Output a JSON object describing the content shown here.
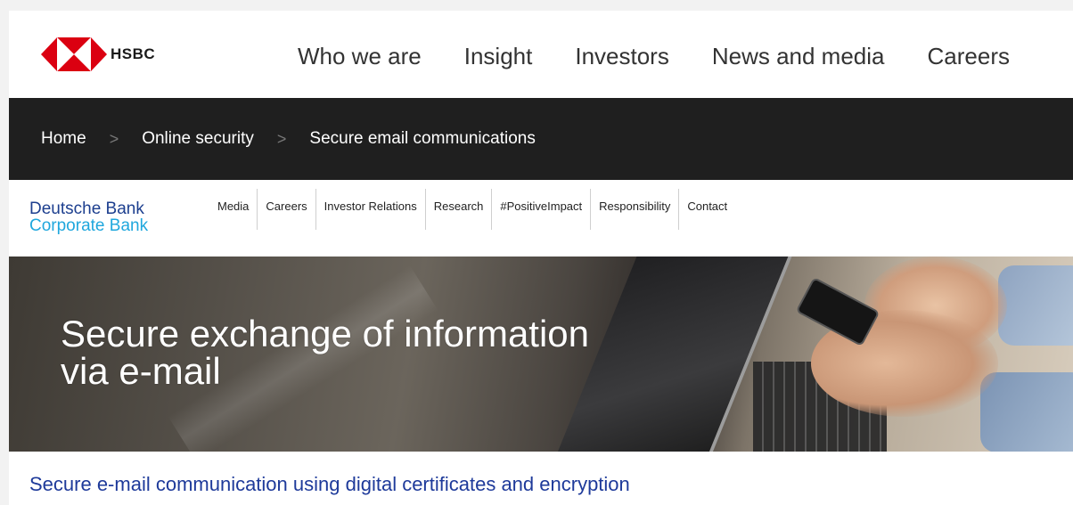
{
  "hsbc": {
    "logo_text": "HSBC",
    "nav": [
      "Who we are",
      "Insight",
      "Investors",
      "News and media",
      "Careers"
    ]
  },
  "breadcrumb": {
    "items": [
      "Home",
      "Online security",
      "Secure email communications"
    ],
    "separator": ">"
  },
  "deutsche_bank": {
    "brand_line1": "Deutsche Bank",
    "brand_line2": "Corporate Bank",
    "nav": [
      "Media",
      "Careers",
      "Investor Relations",
      "Research",
      "#PositiveImpact",
      "Responsibility",
      "Contact"
    ]
  },
  "hero": {
    "title_line1": "Secure exchange of information",
    "title_line2": "via e-mail"
  },
  "subheading": "Secure e-mail communication using digital certificates and encryption",
  "colors": {
    "hsbc_red": "#db0011",
    "breadcrumb_bg": "#1f1f1f",
    "db_blue": "#1d3f8f",
    "db_light_blue": "#1fa7dd",
    "subheading_blue": "#1e3a9a"
  }
}
